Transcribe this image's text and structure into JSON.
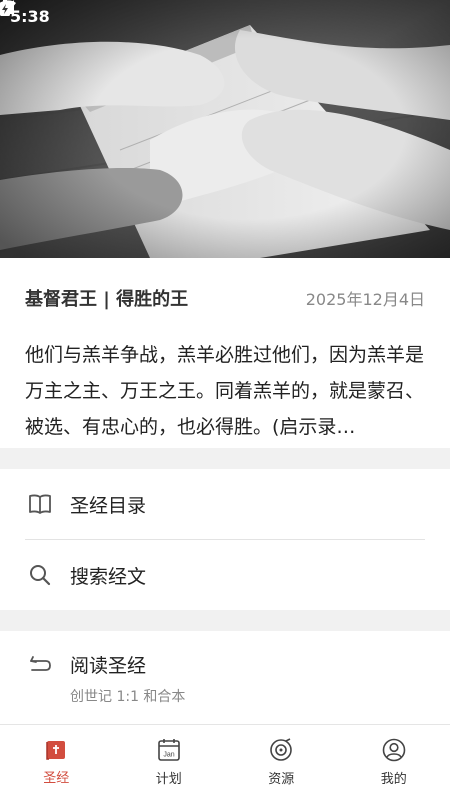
{
  "status_bar": {
    "time": "5:38"
  },
  "hero": {
    "image": "hands-praying-over-bible"
  },
  "verse": {
    "title": "基督君王 | 得胜的王",
    "date": "2025年12月4日",
    "text": "他们与羔羊争战，羔羊必胜过他们，因为羔羊是万主之主、万王之王。同着羔羊的，就是蒙召、被选、有忠心的，也必得胜。(启示录…"
  },
  "menu": {
    "catalog": {
      "label": "圣经目录",
      "icon": "book-open-icon"
    },
    "search": {
      "label": "搜索经文",
      "icon": "search-icon"
    }
  },
  "reading": {
    "label": "阅读圣经",
    "subtitle": "创世记 1:1 和合本",
    "icon": "return-arrow-icon"
  },
  "bottom_nav": {
    "items": [
      {
        "label": "圣经",
        "icon": "bible-icon",
        "active": true
      },
      {
        "label": "计划",
        "icon": "calendar-icon",
        "active": false
      },
      {
        "label": "资源",
        "icon": "disc-icon",
        "active": false
      },
      {
        "label": "我的",
        "icon": "user-icon",
        "active": false
      }
    ]
  },
  "colors": {
    "accent": "#d24d3f",
    "text": "#222222",
    "muted": "#888888",
    "separator": "#f1f1f1"
  }
}
